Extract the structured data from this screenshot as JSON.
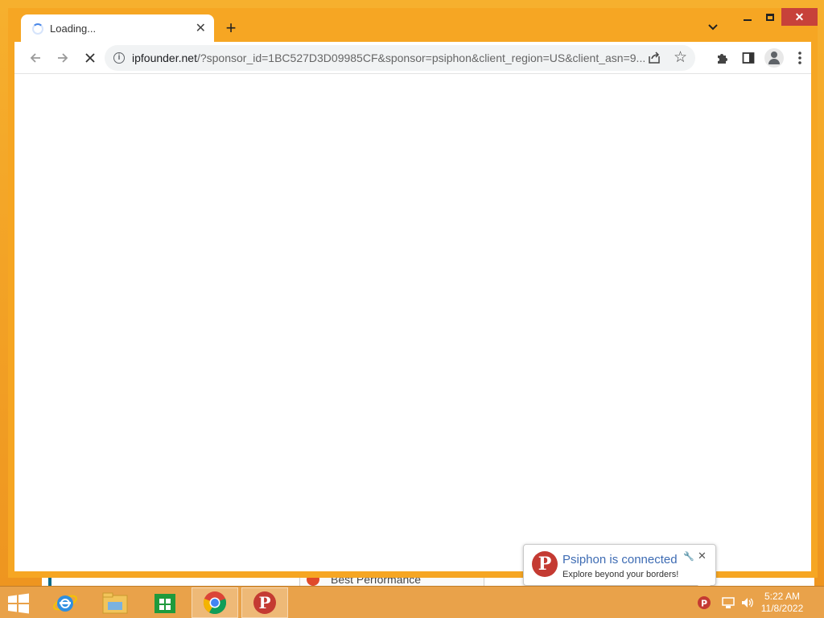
{
  "browser": {
    "tab": {
      "title": "Loading...",
      "close_icon": "close-icon"
    },
    "new_tab_label": "+",
    "url_host": "ipfounder.net",
    "url_rest": "/?sponsor_id=1BC527D3D09985CF&sponsor=psiphon&client_region=US&client_asn=9...",
    "window_buttons": {
      "minimize": "minimize-icon",
      "maximize": "maximize-icon",
      "close": "close-icon"
    }
  },
  "background_window": {
    "tab_text": "Best Performance"
  },
  "notification": {
    "title": "Psiphon is connected",
    "subtitle": "Explore beyond your borders!",
    "logo_letter": "P"
  },
  "taskbar": {
    "apps": [
      "Internet Explorer",
      "File Explorer",
      "Store",
      "Google Chrome",
      "Psiphon"
    ],
    "tray_logo_letter": "P"
  },
  "clock": {
    "time": "5:22 AM",
    "date": "11/8/2022"
  },
  "colors": {
    "accent": "#f6a623",
    "close_button": "#c7413a",
    "psiphon": "#c43a32"
  }
}
